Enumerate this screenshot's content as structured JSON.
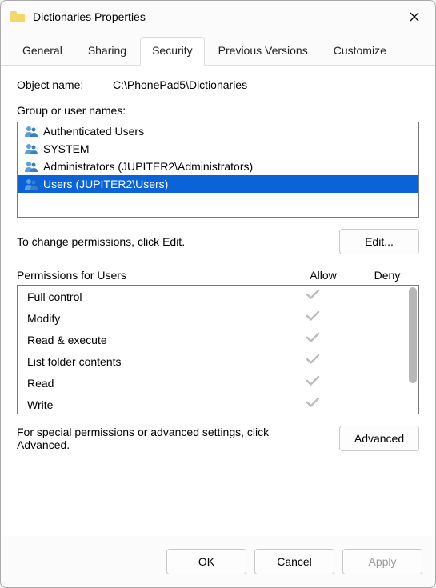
{
  "window": {
    "title": "Dictionaries Properties"
  },
  "tabs": [
    {
      "label": "General",
      "active": false
    },
    {
      "label": "Sharing",
      "active": false
    },
    {
      "label": "Security",
      "active": true
    },
    {
      "label": "Previous Versions",
      "active": false
    },
    {
      "label": "Customize",
      "active": false
    }
  ],
  "object_name": {
    "label": "Object name:",
    "value": "C:\\PhonePad5\\Dictionaries"
  },
  "groups": {
    "label": "Group or user names:",
    "items": [
      {
        "name": "Authenticated Users",
        "selected": false
      },
      {
        "name": "SYSTEM",
        "selected": false
      },
      {
        "name": "Administrators (JUPITER2\\Administrators)",
        "selected": false
      },
      {
        "name": "Users (JUPITER2\\Users)",
        "selected": true
      }
    ]
  },
  "edit": {
    "text": "To change permissions, click Edit.",
    "button": "Edit..."
  },
  "permissions": {
    "label": "Permissions for Users",
    "col_allow": "Allow",
    "col_deny": "Deny",
    "rows": [
      {
        "name": "Full control",
        "allow": true,
        "deny": false
      },
      {
        "name": "Modify",
        "allow": true,
        "deny": false
      },
      {
        "name": "Read & execute",
        "allow": true,
        "deny": false
      },
      {
        "name": "List folder contents",
        "allow": true,
        "deny": false
      },
      {
        "name": "Read",
        "allow": true,
        "deny": false
      },
      {
        "name": "Write",
        "allow": true,
        "deny": false
      }
    ]
  },
  "advanced": {
    "text": "For special permissions or advanced settings, click Advanced.",
    "button": "Advanced"
  },
  "footer": {
    "ok": "OK",
    "cancel": "Cancel",
    "apply": "Apply"
  },
  "colors": {
    "selection": "#0a64d8",
    "check_gray": "#bdbdbd",
    "folder": "#f6d66a"
  }
}
